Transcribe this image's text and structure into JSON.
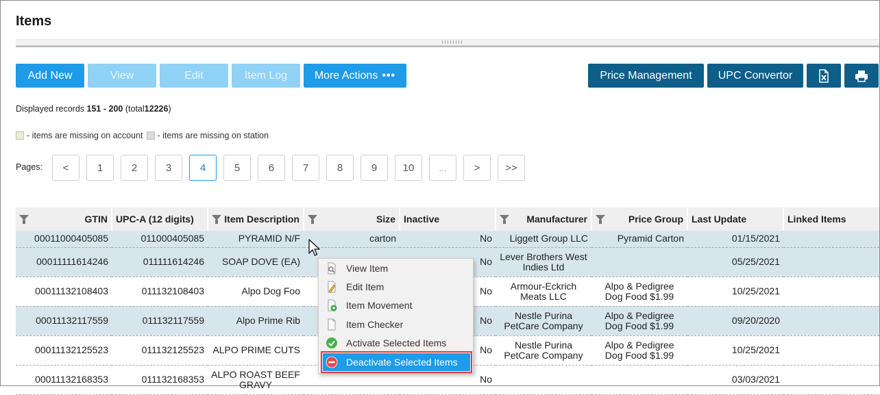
{
  "page": {
    "title": "Items"
  },
  "toolbar": {
    "add_new": "Add New",
    "view": "View",
    "edit": "Edit",
    "item_log": "Item Log",
    "more_actions": "More Actions",
    "more_dots": "•••",
    "price_management": "Price Management",
    "upc_convertor": "UPC Convertor",
    "excel_icon": "excel-export-icon",
    "print_icon": "print-icon"
  },
  "records": {
    "prefix": "Displayed records",
    "from": "151",
    "dash": "-",
    "to": "200",
    "total_label": "(total",
    "total": "12226",
    "close": ")"
  },
  "legend": {
    "account": "- items are missing on account",
    "station": "- items are missing on station",
    "account_color": "#ecedcf",
    "station_color": "#dcdcdc"
  },
  "pagination": {
    "label": "Pages:",
    "buttons": [
      "<",
      "1",
      "2",
      "3",
      "4",
      "5",
      "6",
      "7",
      "8",
      "9",
      "10",
      "...",
      ">",
      ">>"
    ],
    "active": "4"
  },
  "table": {
    "headers": {
      "gtin": "GTIN",
      "upca": "UPC-A (12 digits)",
      "description": "Item Description",
      "size": "Size",
      "inactive": "Inactive",
      "manufacturer": "Manufacturer",
      "price_group": "Price Group",
      "last_update": "Last Update",
      "linked_items": "Linked Items"
    },
    "rows": [
      {
        "gtin": "00011000405085",
        "upca": "011000405085",
        "description": "PYRAMID N/F",
        "size": "carton",
        "inactive": "No",
        "manufacturer": "Liggett Group LLC",
        "price_group": "Pyramid Carton",
        "last_update": "01/15/2021",
        "linked": ""
      },
      {
        "gtin": "00011111614246",
        "upca": "011111614246",
        "description": "SOAP DOVE (EA)",
        "size": "",
        "inactive": "No",
        "manufacturer": "Lever Brothers West Indies Ltd",
        "price_group": "",
        "last_update": "05/25/2021",
        "linked": ""
      },
      {
        "gtin": "00011132108403",
        "upca": "011132108403",
        "description": "Alpo Dog Foo",
        "size": "",
        "inactive": "No",
        "manufacturer": "Armour-Eckrich Meats LLC",
        "price_group": "Alpo & Pedigree Dog Food $1.99",
        "last_update": "10/25/2021",
        "linked": ""
      },
      {
        "gtin": "00011132117559",
        "upca": "011132117559",
        "description": "Alpo Prime Rib",
        "size": "",
        "inactive": "No",
        "manufacturer": "Nestle Purina PetCare Company",
        "price_group": "Alpo & Pedigree Dog Food $1.99",
        "last_update": "09/20/2020",
        "linked": ""
      },
      {
        "gtin": "00011132125523",
        "upca": "011132125523",
        "description": "ALPO PRIME CUTS",
        "size": "",
        "inactive": "No",
        "manufacturer": "Nestle Purina PetCare Company",
        "price_group": "Alpo & Pedigree Dog Food $1.99",
        "last_update": "10/25/2021",
        "linked": ""
      },
      {
        "gtin": "00011132168353",
        "upca": "011132168353",
        "description": "ALPO ROAST BEEF GRAVY",
        "size": "",
        "inactive": "No",
        "manufacturer": "",
        "price_group": "",
        "last_update": "03/03/2021",
        "linked": ""
      }
    ]
  },
  "context_menu": {
    "items": [
      {
        "label": "View Item",
        "icon": "view-item-icon"
      },
      {
        "label": "Edit Item",
        "icon": "edit-item-icon"
      },
      {
        "label": "Item Movement",
        "icon": "item-movement-icon"
      },
      {
        "label": "Item Checker",
        "icon": "item-checker-icon"
      },
      {
        "label": "Activate Selected Items",
        "icon": "activate-check-icon"
      },
      {
        "label": "Deactivate Selected Items",
        "icon": "deactivate-minus-icon"
      }
    ],
    "highlighted": "Deactivate Selected Items",
    "highlight_color": "#1e9be9",
    "outline_color": "#e5393a"
  }
}
